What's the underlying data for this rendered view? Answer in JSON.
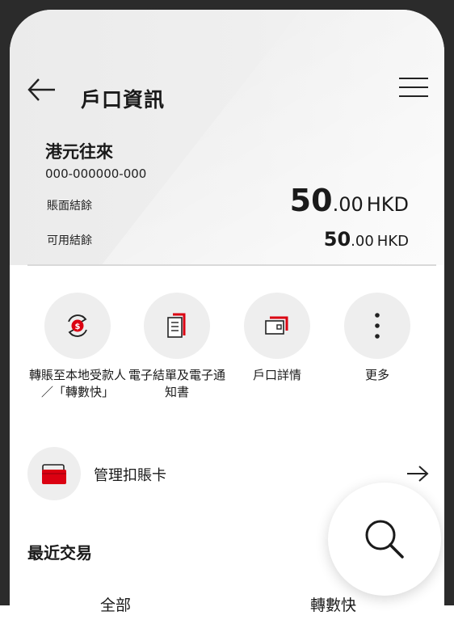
{
  "header": {
    "title": "戶口資訊",
    "back_icon": "arrow-left-icon",
    "menu_icon": "hamburger-menu-icon"
  },
  "account": {
    "name": "港元往來",
    "number": "000-000000-000",
    "ledger_label": "賬面結餘",
    "ledger_whole": "50",
    "ledger_decimal": ".00",
    "ledger_currency": "HKD",
    "available_label": "可用結餘",
    "available_whole": "50",
    "available_decimal": ".00",
    "available_currency": "HKD"
  },
  "actions": [
    {
      "label": "轉賬至本地受款人／「轉數快」",
      "icon": "transfer-icon"
    },
    {
      "label": "電子結單及電子通知書",
      "icon": "estatement-icon"
    },
    {
      "label": "戶口詳情",
      "icon": "account-details-icon"
    },
    {
      "label": "更多",
      "icon": "more-icon"
    }
  ],
  "card_manage": {
    "label": "管理扣賬卡",
    "icon": "debit-card-icon"
  },
  "recent": {
    "title": "最近交易",
    "tabs": [
      "全部",
      "轉數快"
    ]
  },
  "fab": {
    "icon": "search-icon"
  },
  "colors": {
    "accent": "#db0011",
    "text": "#1a1a1a",
    "header_bg": "#eeeeee"
  }
}
